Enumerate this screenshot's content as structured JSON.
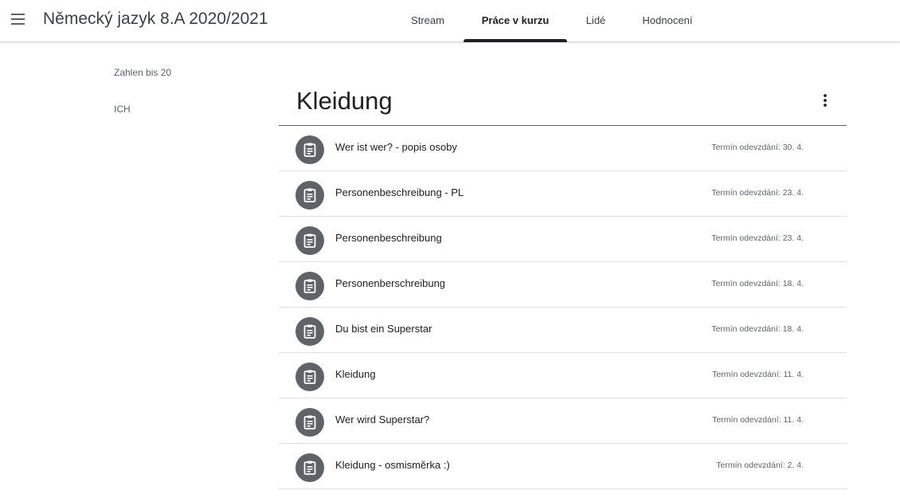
{
  "header": {
    "course_title": "Německý jazyk 8.A 2020/2021",
    "tabs": [
      {
        "label": "Stream",
        "active": false
      },
      {
        "label": "Práce v kurzu",
        "active": true
      },
      {
        "label": "Lidé",
        "active": false
      },
      {
        "label": "Hodnocení",
        "active": false
      }
    ]
  },
  "sidebar": {
    "topics": [
      "Zahlen bis 20",
      "ICH"
    ]
  },
  "section": {
    "title": "Kleidung",
    "assignments": [
      {
        "title": "Wer ist wer? - popis osoby",
        "due": "Termín odevzdání: 30. 4."
      },
      {
        "title": "Personenbeschreibung - PL",
        "due": "Termín odevzdání: 23. 4."
      },
      {
        "title": "Personenbeschreibung",
        "due": "Termín odevzdání: 23. 4."
      },
      {
        "title": "Personenberschreibung",
        "due": "Termín odevzdání: 18. 4."
      },
      {
        "title": "Du bist ein Superstar",
        "due": "Termín odevzdání: 18. 4."
      },
      {
        "title": "Kleidung",
        "due": "Termín odevzdání: 11. 4."
      },
      {
        "title": "Wer wird Superstar?",
        "due": "Termín odevzdání: 11. 4."
      },
      {
        "title": "Kleidung - osmisměrka :)",
        "due": "Termín odevzdání: 2. 4."
      }
    ]
  },
  "icons": {
    "menu": "hamburger-menu-icon",
    "more": "more-vertical-icon",
    "assignment": "assignment-clipboard-icon"
  },
  "colors": {
    "icon_bg": "#5f6368",
    "active_tab": "#202124",
    "text_secondary": "#5f6368"
  }
}
